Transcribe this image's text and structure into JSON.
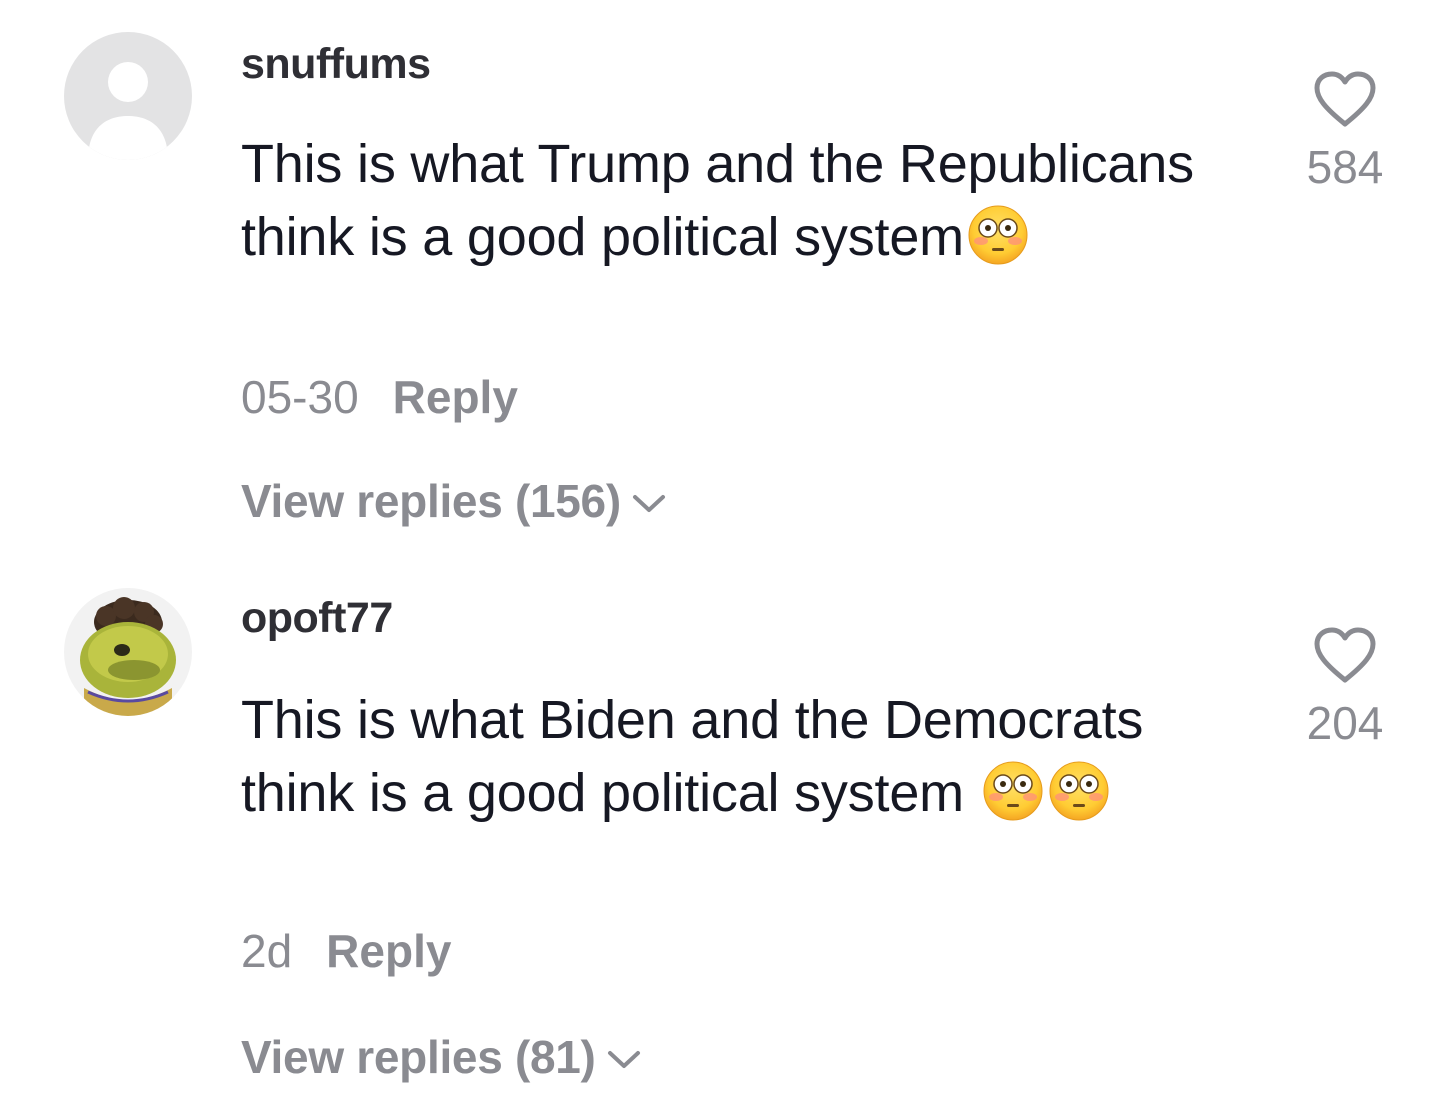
{
  "comments": [
    {
      "username": "snuffums",
      "text": "This is what Trump and the Republicans think is a good political system",
      "emoji": "flushed-face",
      "emoji_count": 1,
      "date": "05-30",
      "reply_label": "Reply",
      "view_replies": "View replies (156)",
      "likes": "584",
      "avatar": "default-avatar"
    },
    {
      "username": "opoft77",
      "text": "This is what Biden and the Democrats think is a good political system ",
      "emoji": "flushed-face",
      "emoji_count": 2,
      "date": "2d",
      "reply_label": "Reply",
      "view_replies": "View replies (81)",
      "likes": "204",
      "avatar": "fish-character-avatar"
    }
  ],
  "colors": {
    "primary_text": "#161823",
    "username": "#2f2f35",
    "secondary_text": "#8a8b91",
    "avatar_default_bg": "#e3e3e4"
  }
}
